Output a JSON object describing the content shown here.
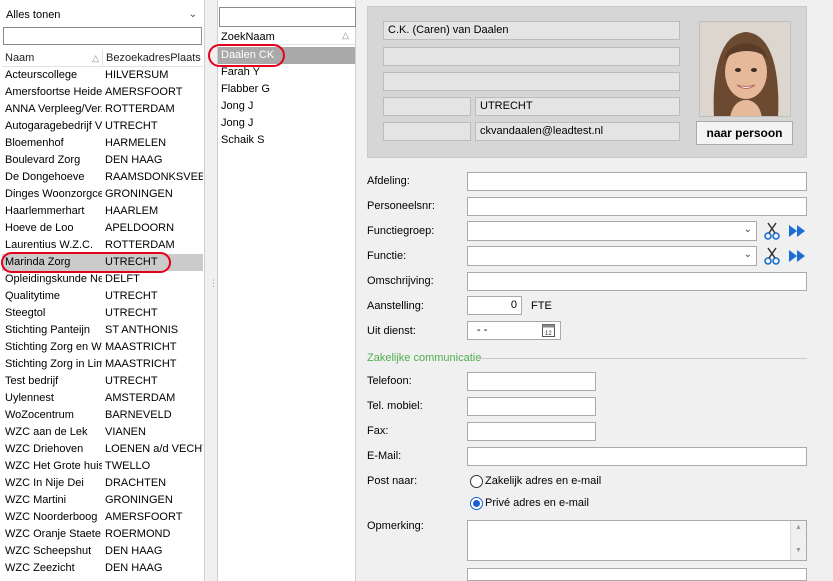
{
  "left": {
    "filter_value": "Alles tonen",
    "columns": [
      "Naam",
      "BezoekadresPlaats"
    ],
    "rows": [
      [
        "Acteurscollege",
        "HILVERSUM"
      ],
      [
        "Amersfoortse Heide",
        "AMERSFOORT"
      ],
      [
        "ANNA Verpleeg/Verzorging",
        "ROTTERDAM"
      ],
      [
        "Autogaragebedrijf V",
        "UTRECHT"
      ],
      [
        "Bloemenhof",
        "HARMELEN"
      ],
      [
        "Boulevard Zorg",
        "DEN HAAG"
      ],
      [
        "De Dongehoeve",
        "RAAMSDONKSVEER"
      ],
      [
        "Dinges Woonzorgcentrum",
        "GRONINGEN"
      ],
      [
        "Haarlemmerhart",
        "HAARLEM"
      ],
      [
        "Hoeve de Loo",
        "APELDOORN"
      ],
      [
        "Laurentius W.Z.C.",
        "ROTTERDAM"
      ],
      [
        "Marinda Zorg",
        "UTRECHT"
      ],
      [
        "Opleidingskunde Nederland",
        "DELFT"
      ],
      [
        "Qualitytime",
        "UTRECHT"
      ],
      [
        "Steegtol",
        "UTRECHT"
      ],
      [
        "Stichting Panteijn",
        "ST ANTHONIS"
      ],
      [
        "Stichting Zorg en Welzijn",
        "MAASTRICHT"
      ],
      [
        "Stichting Zorg in Limburg",
        "MAASTRICHT"
      ],
      [
        "Test bedrijf",
        "UTRECHT"
      ],
      [
        "Uylennest",
        "AMSTERDAM"
      ],
      [
        "WoZocentrum",
        "BARNEVELD"
      ],
      [
        "WZC aan de Lek",
        "VIANEN"
      ],
      [
        "WZC Driehoven",
        "LOENEN a/d VECHT"
      ],
      [
        "WZC Het Grote huis",
        "TWELLO"
      ],
      [
        "WZC In Nije Dei",
        "DRACHTEN"
      ],
      [
        "WZC Martini",
        "GRONINGEN"
      ],
      [
        "WZC Noorderboog",
        "AMERSFOORT"
      ],
      [
        "WZC Oranje Staete",
        "ROERMOND"
      ],
      [
        "WZC Scheepshut",
        "DEN HAAG"
      ],
      [
        "WZC Zeezicht",
        "DEN HAAG"
      ]
    ],
    "selected_index": 11
  },
  "middle": {
    "column": "ZoekNaam",
    "rows": [
      "Daalen CK",
      "Farah Y",
      "Flabber G",
      "Jong J",
      "Jong J",
      "Schaik S"
    ],
    "selected_index": 0
  },
  "card": {
    "line1": "C.K. (Caren) van Daalen",
    "line2": "",
    "line3": "",
    "postcode": "",
    "city": "UTRECHT",
    "label5": "",
    "email": "ckvandaalen@leadtest.nl",
    "to_person_label": "naar persoon"
  },
  "form": {
    "afdeling_label": "Afdeling:",
    "personeelsnr_label": "Personeelsnr:",
    "functiegroep_label": "Functiegroep:",
    "functie_label": "Functie:",
    "omschrijving_label": "Omschrijving:",
    "aanstelling_label": "Aanstelling:",
    "aanstelling_value": "0",
    "fte_label": "FTE",
    "uit_dienst_label": "Uit dienst:",
    "uit_dienst_value": "- -",
    "section_title": "Zakelijke communicatie",
    "telefoon_label": "Telefoon:",
    "mobiel_label": "Tel. mobiel:",
    "fax_label": "Fax:",
    "email_label": "E-Mail:",
    "post_naar_label": "Post naar:",
    "post_option1": "Zakelijk adres en e-mail",
    "post_option2": "Privé adres en e-mail",
    "opmerking_label": "Opmerking:"
  },
  "colors": {
    "highlight": "#e2001a",
    "section": "#4fae4f",
    "accent": "#1a5fd0"
  }
}
